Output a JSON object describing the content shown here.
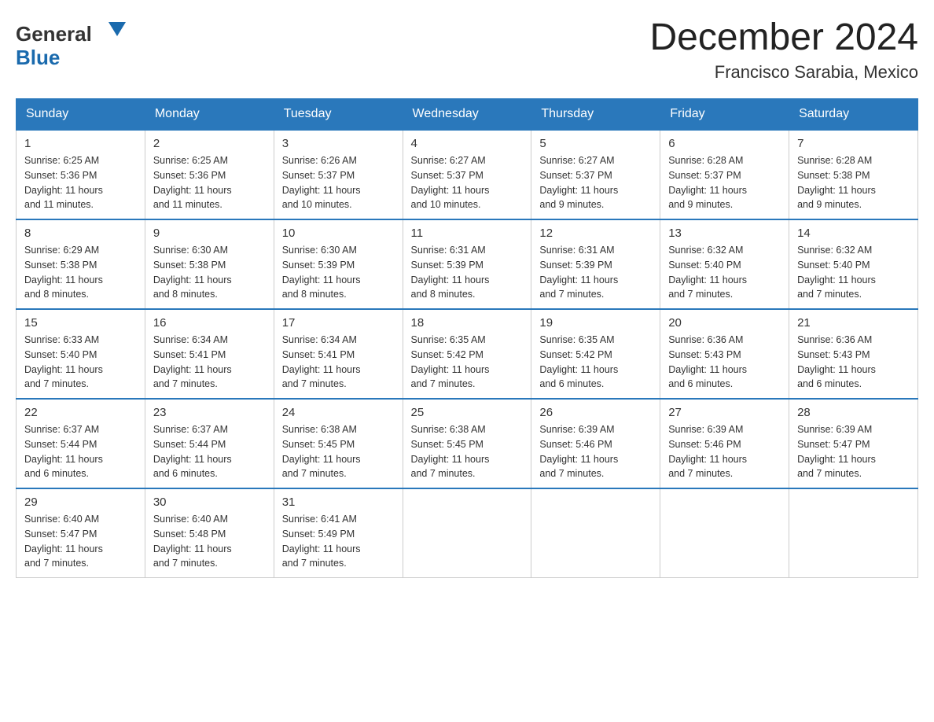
{
  "header": {
    "logo_general": "General",
    "logo_blue": "Blue",
    "month_title": "December 2024",
    "location": "Francisco Sarabia, Mexico"
  },
  "days_of_week": [
    "Sunday",
    "Monday",
    "Tuesday",
    "Wednesday",
    "Thursday",
    "Friday",
    "Saturday"
  ],
  "weeks": [
    [
      {
        "day": "1",
        "info": "Sunrise: 6:25 AM\nSunset: 5:36 PM\nDaylight: 11 hours\nand 11 minutes."
      },
      {
        "day": "2",
        "info": "Sunrise: 6:25 AM\nSunset: 5:36 PM\nDaylight: 11 hours\nand 11 minutes."
      },
      {
        "day": "3",
        "info": "Sunrise: 6:26 AM\nSunset: 5:37 PM\nDaylight: 11 hours\nand 10 minutes."
      },
      {
        "day": "4",
        "info": "Sunrise: 6:27 AM\nSunset: 5:37 PM\nDaylight: 11 hours\nand 10 minutes."
      },
      {
        "day": "5",
        "info": "Sunrise: 6:27 AM\nSunset: 5:37 PM\nDaylight: 11 hours\nand 9 minutes."
      },
      {
        "day": "6",
        "info": "Sunrise: 6:28 AM\nSunset: 5:37 PM\nDaylight: 11 hours\nand 9 minutes."
      },
      {
        "day": "7",
        "info": "Sunrise: 6:28 AM\nSunset: 5:38 PM\nDaylight: 11 hours\nand 9 minutes."
      }
    ],
    [
      {
        "day": "8",
        "info": "Sunrise: 6:29 AM\nSunset: 5:38 PM\nDaylight: 11 hours\nand 8 minutes."
      },
      {
        "day": "9",
        "info": "Sunrise: 6:30 AM\nSunset: 5:38 PM\nDaylight: 11 hours\nand 8 minutes."
      },
      {
        "day": "10",
        "info": "Sunrise: 6:30 AM\nSunset: 5:39 PM\nDaylight: 11 hours\nand 8 minutes."
      },
      {
        "day": "11",
        "info": "Sunrise: 6:31 AM\nSunset: 5:39 PM\nDaylight: 11 hours\nand 8 minutes."
      },
      {
        "day": "12",
        "info": "Sunrise: 6:31 AM\nSunset: 5:39 PM\nDaylight: 11 hours\nand 7 minutes."
      },
      {
        "day": "13",
        "info": "Sunrise: 6:32 AM\nSunset: 5:40 PM\nDaylight: 11 hours\nand 7 minutes."
      },
      {
        "day": "14",
        "info": "Sunrise: 6:32 AM\nSunset: 5:40 PM\nDaylight: 11 hours\nand 7 minutes."
      }
    ],
    [
      {
        "day": "15",
        "info": "Sunrise: 6:33 AM\nSunset: 5:40 PM\nDaylight: 11 hours\nand 7 minutes."
      },
      {
        "day": "16",
        "info": "Sunrise: 6:34 AM\nSunset: 5:41 PM\nDaylight: 11 hours\nand 7 minutes."
      },
      {
        "day": "17",
        "info": "Sunrise: 6:34 AM\nSunset: 5:41 PM\nDaylight: 11 hours\nand 7 minutes."
      },
      {
        "day": "18",
        "info": "Sunrise: 6:35 AM\nSunset: 5:42 PM\nDaylight: 11 hours\nand 7 minutes."
      },
      {
        "day": "19",
        "info": "Sunrise: 6:35 AM\nSunset: 5:42 PM\nDaylight: 11 hours\nand 6 minutes."
      },
      {
        "day": "20",
        "info": "Sunrise: 6:36 AM\nSunset: 5:43 PM\nDaylight: 11 hours\nand 6 minutes."
      },
      {
        "day": "21",
        "info": "Sunrise: 6:36 AM\nSunset: 5:43 PM\nDaylight: 11 hours\nand 6 minutes."
      }
    ],
    [
      {
        "day": "22",
        "info": "Sunrise: 6:37 AM\nSunset: 5:44 PM\nDaylight: 11 hours\nand 6 minutes."
      },
      {
        "day": "23",
        "info": "Sunrise: 6:37 AM\nSunset: 5:44 PM\nDaylight: 11 hours\nand 6 minutes."
      },
      {
        "day": "24",
        "info": "Sunrise: 6:38 AM\nSunset: 5:45 PM\nDaylight: 11 hours\nand 7 minutes."
      },
      {
        "day": "25",
        "info": "Sunrise: 6:38 AM\nSunset: 5:45 PM\nDaylight: 11 hours\nand 7 minutes."
      },
      {
        "day": "26",
        "info": "Sunrise: 6:39 AM\nSunset: 5:46 PM\nDaylight: 11 hours\nand 7 minutes."
      },
      {
        "day": "27",
        "info": "Sunrise: 6:39 AM\nSunset: 5:46 PM\nDaylight: 11 hours\nand 7 minutes."
      },
      {
        "day": "28",
        "info": "Sunrise: 6:39 AM\nSunset: 5:47 PM\nDaylight: 11 hours\nand 7 minutes."
      }
    ],
    [
      {
        "day": "29",
        "info": "Sunrise: 6:40 AM\nSunset: 5:47 PM\nDaylight: 11 hours\nand 7 minutes."
      },
      {
        "day": "30",
        "info": "Sunrise: 6:40 AM\nSunset: 5:48 PM\nDaylight: 11 hours\nand 7 minutes."
      },
      {
        "day": "31",
        "info": "Sunrise: 6:41 AM\nSunset: 5:49 PM\nDaylight: 11 hours\nand 7 minutes."
      },
      null,
      null,
      null,
      null
    ]
  ]
}
